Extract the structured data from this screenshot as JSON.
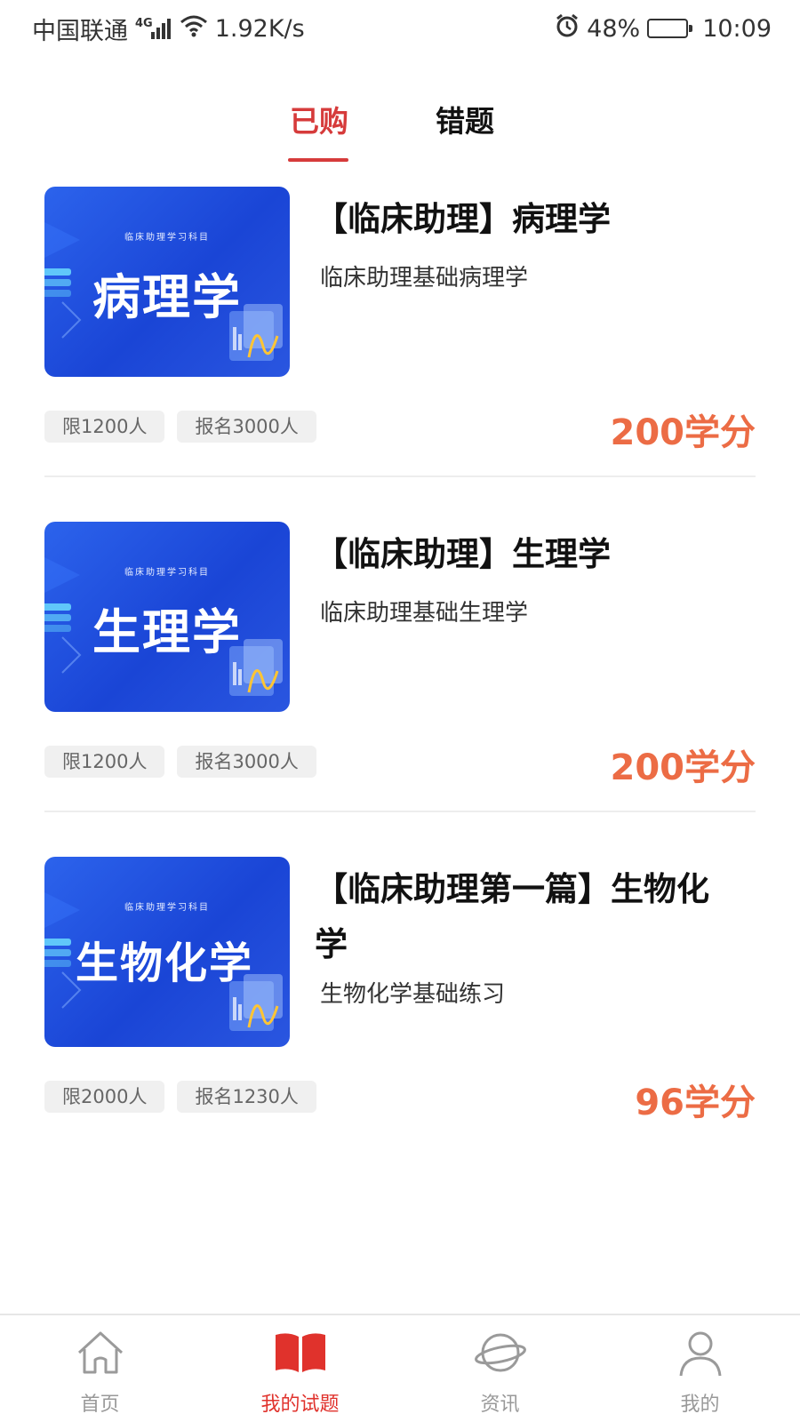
{
  "status_bar": {
    "carrier": "中国联通",
    "network": "4G",
    "speed": "1.92K/s",
    "battery": "48%",
    "battery_level": 0.48,
    "time": "10:09"
  },
  "tabs": [
    {
      "label": "已购",
      "active": true
    },
    {
      "label": "错题",
      "active": false
    }
  ],
  "courses": [
    {
      "thumb_subtitle": "临床助理学习科目",
      "thumb_title": "病理学",
      "title": "【临床助理】病理学",
      "description": "临床助理基础病理学",
      "tag_limit": "限1200人",
      "tag_enrolled": "报名3000人",
      "price": "200学分"
    },
    {
      "thumb_subtitle": "临床助理学习科目",
      "thumb_title": "生理学",
      "title": "【临床助理】生理学",
      "description": "临床助理基础生理学",
      "tag_limit": "限1200人",
      "tag_enrolled": "报名3000人",
      "price": "200学分"
    },
    {
      "thumb_subtitle": "临床助理学习科目",
      "thumb_title": "生物化学",
      "title": "【临床助理第一篇】生物化学",
      "description": "生物化学基础练习",
      "tag_limit": "限2000人",
      "tag_enrolled": "报名1230人",
      "price": "96学分"
    }
  ],
  "bottom_nav": [
    {
      "label": "首页",
      "icon": "home-icon",
      "active": false
    },
    {
      "label": "我的试题",
      "icon": "book-icon",
      "active": true
    },
    {
      "label": "资讯",
      "icon": "planet-icon",
      "active": false
    },
    {
      "label": "我的",
      "icon": "user-icon",
      "active": false
    }
  ],
  "colors": {
    "accent": "#d63b3b",
    "price": "#ec6c45",
    "nav_active": "#e0322c",
    "thumb_blue": "#1a45d6"
  }
}
